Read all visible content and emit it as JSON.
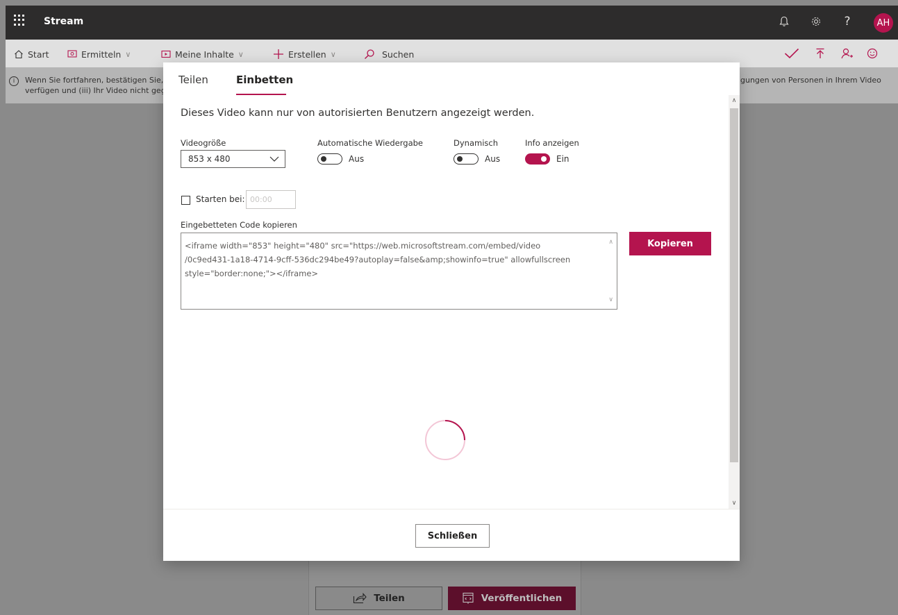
{
  "header": {
    "app_title": "Stream",
    "avatar_initials": "AH",
    "help_label": "?"
  },
  "nav": {
    "start": "Start",
    "discover": "Ermitteln",
    "my_content": "Meine Inhalte",
    "create": "Erstellen",
    "search": "Suchen"
  },
  "notice": {
    "line1": "Wenn Sie fortfahren, bestätigen Sie,",
    "line2": "verfügen und (iii) Ihr Video nicht geg",
    "line1_right": "gungen von Personen in Ihrem Video"
  },
  "background": {
    "share_label": "Teilen",
    "publish_label": "Veröffentlichen"
  },
  "dialog": {
    "tabs": [
      "Teilen",
      "Einbetten"
    ],
    "active_tab": "Einbetten",
    "description": "Dieses Video kann nur von autorisierten Benutzern angezeigt werden.",
    "video_size_label": "Videogröße",
    "video_size_value": "853 x 480",
    "autoplay_label": "Automatische Wiedergabe",
    "autoplay_state": "Aus",
    "dynamic_label": "Dynamisch",
    "dynamic_state": "Aus",
    "show_info_label": "Info anzeigen",
    "show_info_state": "Ein",
    "start_at_label": "Starten bei:",
    "start_at_placeholder": "00:00",
    "embed_code_label": "Eingebetteten Code kopieren",
    "embed_code_lines": [
      "<iframe width=\"853\" height=\"480\" src=\"https://web.microsoftstream.com/embed/video",
      "/0c9ed431-1a18-4714-9cff-536dc294be49?autoplay=false&amp;showinfo=true\" allowfullscreen",
      "style=\"border:none;\"></iframe>"
    ],
    "copy_label": "Kopieren",
    "close_label": "Schließen"
  },
  "colors": {
    "accent": "#b4144e",
    "topbar": "#2d2c2c"
  }
}
